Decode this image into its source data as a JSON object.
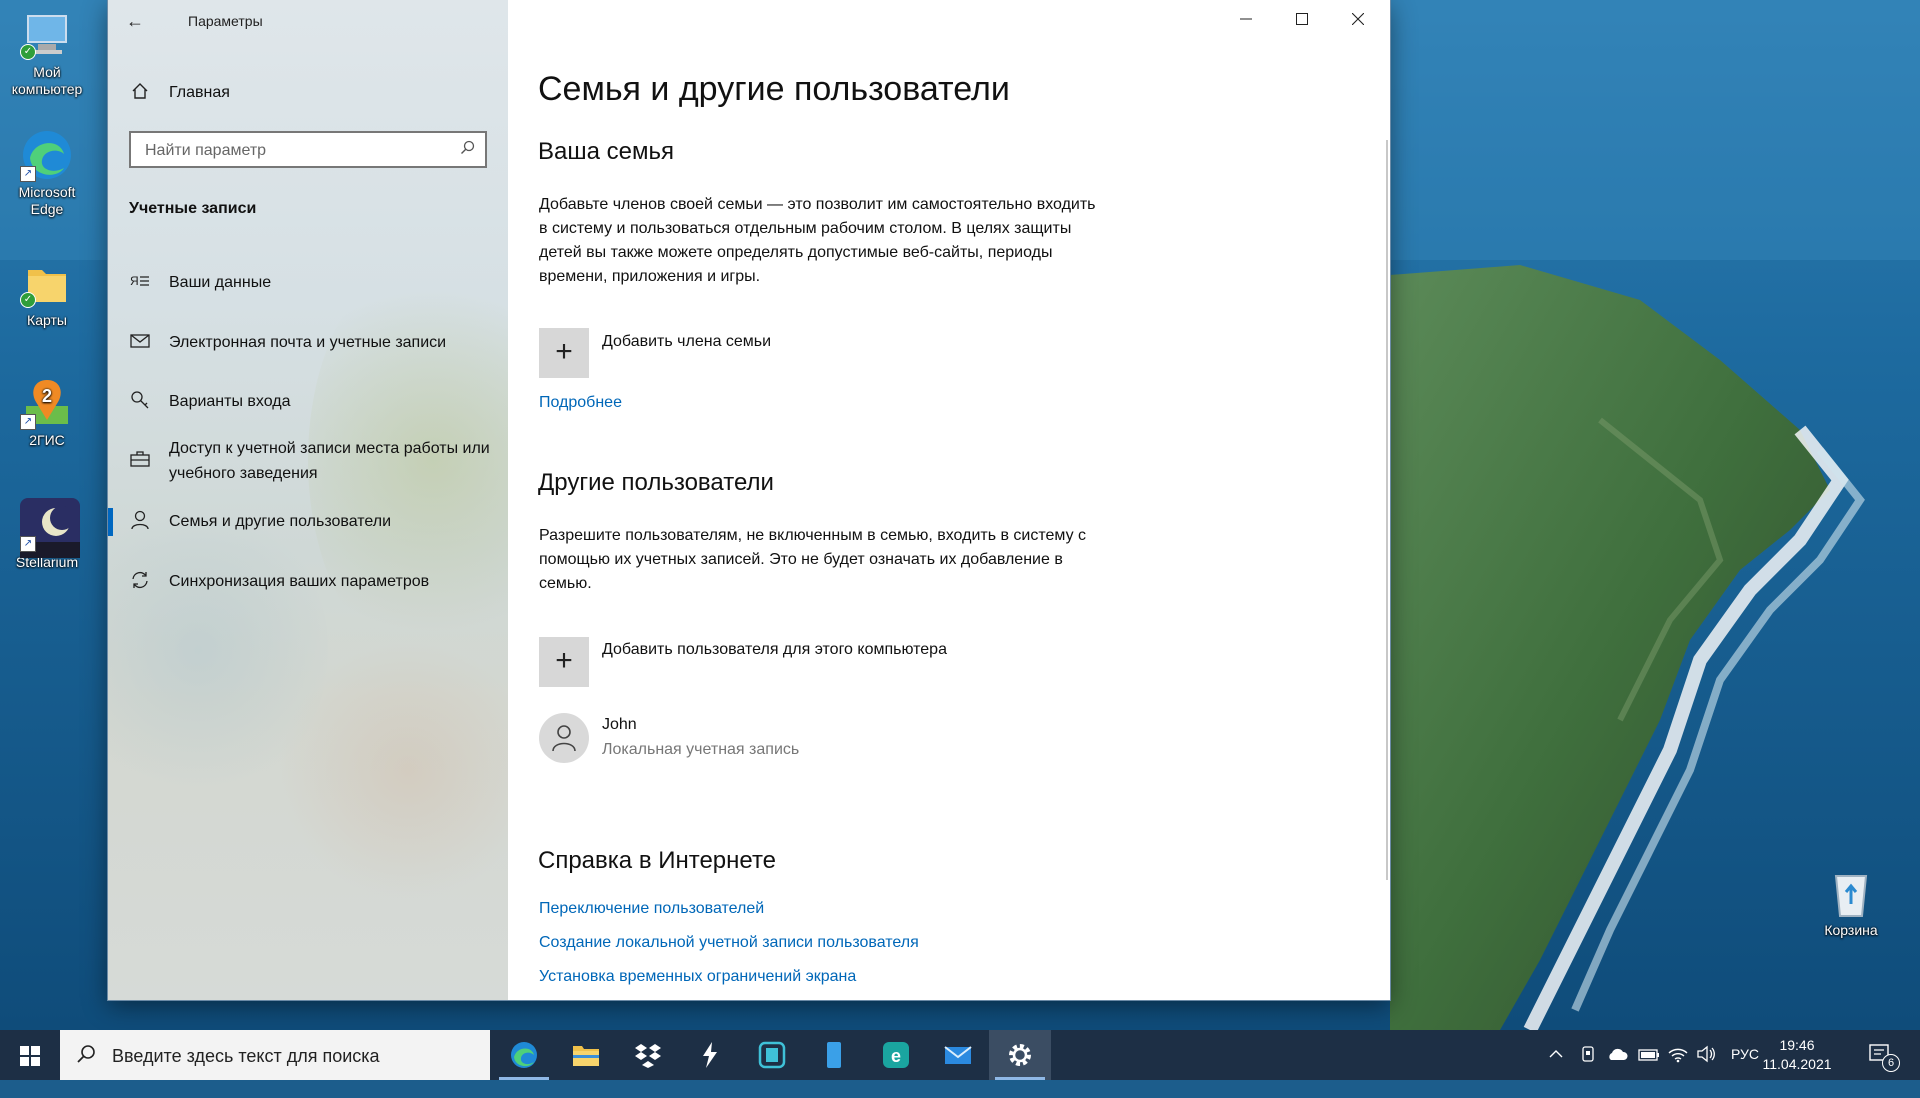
{
  "desktop": {
    "icons": [
      {
        "label": "Мой компьютер"
      },
      {
        "label": "Microsoft Edge"
      },
      {
        "label": "Карты"
      },
      {
        "label": "2ГИС"
      },
      {
        "label": "Stellarium"
      },
      {
        "label": "Корзина"
      }
    ]
  },
  "window": {
    "title": "Параметры",
    "caption": {
      "minimize": "—",
      "maximize": "☐",
      "close": "✕"
    }
  },
  "sidebar": {
    "home_label": "Главная",
    "search_placeholder": "Найти параметр",
    "section_title": "Учетные записи",
    "items": [
      {
        "label": "Ваши данные",
        "icon": "person-card-icon"
      },
      {
        "label": "Электронная почта и учетные записи",
        "icon": "mail-icon"
      },
      {
        "label": "Варианты входа",
        "icon": "key-icon"
      },
      {
        "label": "Доступ к учетной записи места работы или учебного заведения",
        "icon": "briefcase-icon"
      },
      {
        "label": "Семья и другие пользователи",
        "icon": "person-icon",
        "active": true
      },
      {
        "label": "Синхронизация ваших параметров",
        "icon": "sync-icon"
      }
    ]
  },
  "content": {
    "page_title": "Семья и другие пользователи",
    "family": {
      "heading": "Ваша семья",
      "description": "Добавьте членов своей семьи — это позволит им самостоятельно входить в систему и пользоваться отдельным рабочим столом. В целях защиты детей вы также можете определять допустимые веб-сайты, периоды времени, приложения и игры.",
      "add_label": "Добавить члена семьи",
      "more_link": "Подробнее"
    },
    "others": {
      "heading": "Другие пользователи",
      "description": "Разрешите пользователям, не включенным в семью, входить в систему с помощью их учетных записей. Это не будет означать их добавление в семью.",
      "add_label": "Добавить пользователя для этого компьютера",
      "user": {
        "name": "John",
        "type": "Локальная учетная запись"
      }
    },
    "help": {
      "heading": "Справка в Интернете",
      "links": [
        "Переключение пользователей",
        "Создание локальной учетной записи пользователя",
        "Установка временных ограничений экрана"
      ]
    }
  },
  "taskbar": {
    "search_placeholder": "Введите здесь текст для поиска",
    "apps": [
      "edge",
      "file-explorer",
      "dropbox",
      "lightning-app",
      "calculator-app",
      "phone-app",
      "ie-app",
      "mail",
      "settings"
    ],
    "language": "РУС",
    "time": "19:46",
    "date": "11.04.2021",
    "notification_count": "6"
  }
}
